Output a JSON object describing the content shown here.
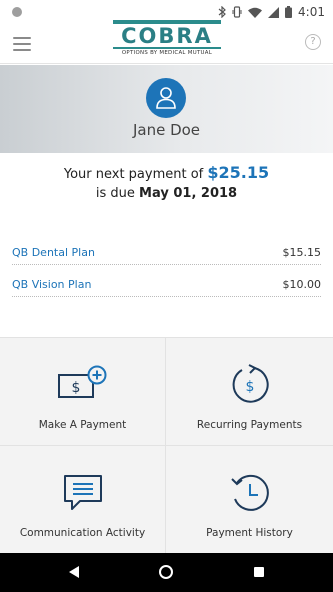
{
  "status_bar": {
    "time": "4:01"
  },
  "header": {
    "logo_word": "COBRA",
    "logo_tagline": "OPTIONS BY MEDICAL MUTUAL",
    "help_label": "?"
  },
  "profile": {
    "name": "Jane Doe"
  },
  "payment": {
    "prefix": "Your next payment of",
    "amount": "$25.15",
    "due_prefix": "is due",
    "due_date": "May 01, 2018"
  },
  "plans": [
    {
      "name": "QB Dental Plan",
      "amount": "$15.15"
    },
    {
      "name": "QB Vision Plan",
      "amount": "$10.00"
    }
  ],
  "actions": [
    {
      "label": "Make A Payment",
      "icon": "make-payment-icon"
    },
    {
      "label": "Recurring Payments",
      "icon": "recurring-payments-icon"
    },
    {
      "label": "Communication Activity",
      "icon": "chat-icon"
    },
    {
      "label": "Payment History",
      "icon": "history-clock-icon"
    }
  ],
  "colors": {
    "accent": "#1d74b8",
    "brand": "#2b7f85",
    "icon_stroke": "#1e3a5a"
  }
}
